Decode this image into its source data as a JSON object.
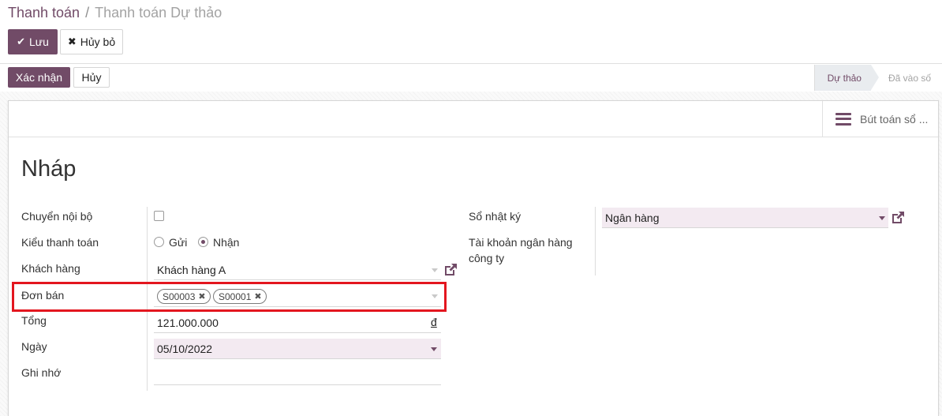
{
  "breadcrumb": {
    "parent": "Thanh toán",
    "separator": "/",
    "current": "Thanh toán Dự thảo"
  },
  "toolbar": {
    "save_label": "Lưu",
    "discard_label": "Hủy bỏ"
  },
  "actions": {
    "confirm_label": "Xác nhận",
    "cancel_label": "Hủy"
  },
  "statusbar": {
    "draft": "Dự thảo",
    "posted": "Đã vào số"
  },
  "smart_button": {
    "label": "Bút toán sổ ...",
    "icon": "list-icon"
  },
  "form": {
    "title": "Nháp",
    "left": {
      "internal_transfer": {
        "label": "Chuyển nội bộ",
        "checked": false
      },
      "payment_type": {
        "label": "Kiểu thanh toán",
        "options": [
          "Gửi",
          "Nhận"
        ],
        "selected": "Nhận"
      },
      "customer": {
        "label": "Khách hàng",
        "value": "Khách hàng A"
      },
      "sale_orders": {
        "label": "Đơn bán",
        "tags": [
          "S00003",
          "S00001"
        ]
      },
      "amount": {
        "label": "Tổng",
        "value": "121.000.000",
        "currency": "đ"
      },
      "date": {
        "label": "Ngày",
        "value": "05/10/2022"
      },
      "memo": {
        "label": "Ghi nhớ",
        "value": ""
      }
    },
    "right": {
      "journal": {
        "label": "Sổ nhật ký",
        "value": "Ngân hàng"
      },
      "bank_account": {
        "label": "Tài khoản ngân hàng công ty"
      }
    }
  },
  "colors": {
    "brand": "#714B67",
    "highlight": "#e3161f",
    "required_bg": "#f3eaf1"
  }
}
